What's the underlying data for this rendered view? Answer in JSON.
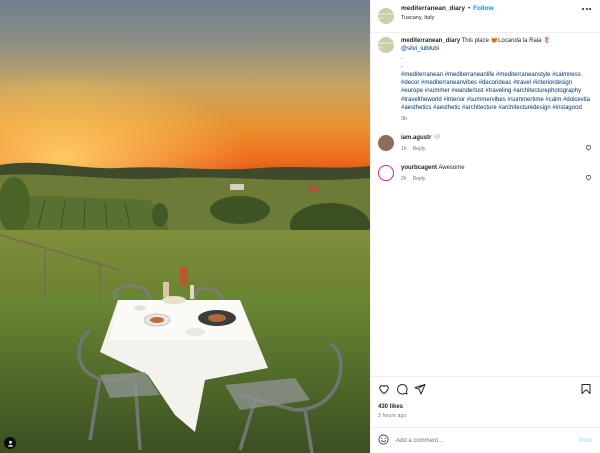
{
  "post": {
    "username": "mediterranean_diary",
    "follow_label": "Follow",
    "location": "Tuscany, Italy",
    "avatar_text": "mediterranean diary"
  },
  "caption": {
    "username": "mediterranean_diary",
    "text_prefix": "This place ",
    "emoji": "😻",
    "text_suffix": "Locanda la Raia ",
    "emoji2": "🌷",
    "mention": "@silvi_lubilubi",
    "dots": [
      ".",
      "."
    ],
    "hashtags": "#mediterranean #mediterraneanlife #mediterraneanstyle #calmness #decor #mediterraneanvibes #decorideas #travel #interiordesign #europe #summer #wanderlust #traveling #architecturephotography #traveltheworld #interior #summervibes #summertime #calm #dolcevita #aesthetics #aesthetic #architecture #architecturedesign #instagood",
    "time": "3h"
  },
  "comments": [
    {
      "username": "iam.agustr",
      "text": "🤍",
      "time": "1h",
      "reply": "Reply"
    },
    {
      "username": "yourbcagent",
      "text": "Awesome",
      "time": "2h",
      "reply": "Reply"
    }
  ],
  "likes": "430 likes",
  "posted_ago": "3 hours ago",
  "add_comment": {
    "placeholder": "Add a comment...",
    "post_label": "Post"
  },
  "icons": [
    "heart-icon",
    "comment-icon",
    "share-icon",
    "bookmark-icon",
    "more-icon",
    "user-tag-icon",
    "emoji-icon"
  ],
  "colors": {
    "accent": "#0095f6",
    "link": "#00376b",
    "muted": "#737373",
    "post_disabled": "#b2dffc"
  }
}
